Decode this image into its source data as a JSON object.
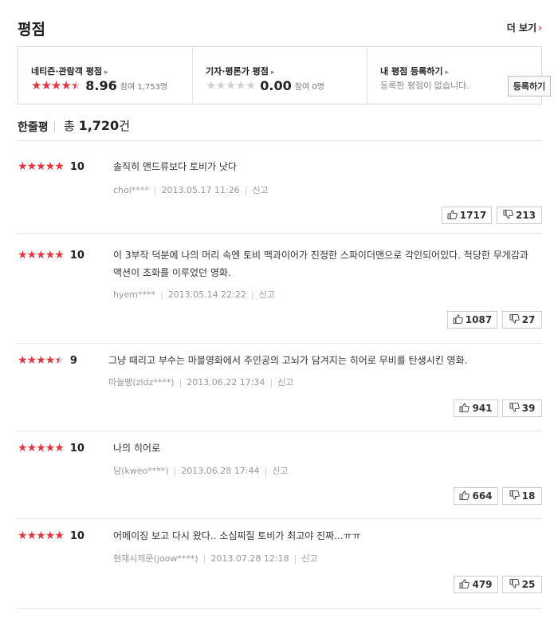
{
  "header": {
    "title": "평점",
    "more_label": "더 보기"
  },
  "summary": {
    "netizen": {
      "title": "네티즌·관람객 평점",
      "score": "8.96",
      "count": "참여 1,753명",
      "stars": 4.5
    },
    "critic": {
      "title": "기자·평론가 평점",
      "score": "0.00",
      "count": "참여 0명",
      "stars": 0
    },
    "mine": {
      "title": "내 평점 등록하기",
      "empty_text": "등록한 평점이 없습니다.",
      "button_label": "등록하기"
    }
  },
  "list": {
    "label": "한줄평",
    "total_prefix": "총 ",
    "total_count": "1,720",
    "total_suffix": "건"
  },
  "reviews": [
    {
      "stars": 5,
      "score": "10",
      "text": "솔직히 앤드류보다 토비가 낫다",
      "user": "choi****",
      "date": "2013.05.17 11:26",
      "report": "신고",
      "likes": "1717",
      "dislikes": "213"
    },
    {
      "stars": 5,
      "score": "10",
      "text": "이 3부작 덕분에 나의 머리 속엔 토비 맥과이어가 진정한 스파이더맨으로 각인되어있다. 적당한 무게감과 액션이 조화를 이루었던 영화.",
      "user": "hyem****",
      "date": "2013.05.14 22:22",
      "report": "신고",
      "likes": "1087",
      "dislikes": "27"
    },
    {
      "stars": 4.5,
      "score": "9",
      "text": "그냥 때리고 부수는 마블영화에서 주인공의 고뇌가 담겨지는 히어로 무비를 탄생시킨 영화.",
      "user": "마늘빵(zldz****)",
      "date": "2013.06.22 17:34",
      "report": "신고",
      "likes": "941",
      "dislikes": "39"
    },
    {
      "stars": 5,
      "score": "10",
      "text": "나의 히어로",
      "user": "담(kweo****)",
      "date": "2013.06.28 17:44",
      "report": "신고",
      "likes": "664",
      "dislikes": "18"
    },
    {
      "stars": 5,
      "score": "10",
      "text": "어메이징 보고 다시 왔다.. 소심찌질 토비가 최고야 진짜...ㅠㅠ",
      "user": "현재시제문(joow****)",
      "date": "2013.07.28 12:18",
      "report": "신고",
      "likes": "479",
      "dislikes": "25"
    }
  ],
  "icons": {
    "more": "chevron-right-icon",
    "like": "thumbs-up-icon",
    "dislike": "thumbs-down-icon",
    "star": "star-icon"
  },
  "colors": {
    "star_red": "#e8333c",
    "star_gray": "#d0d0d0"
  }
}
